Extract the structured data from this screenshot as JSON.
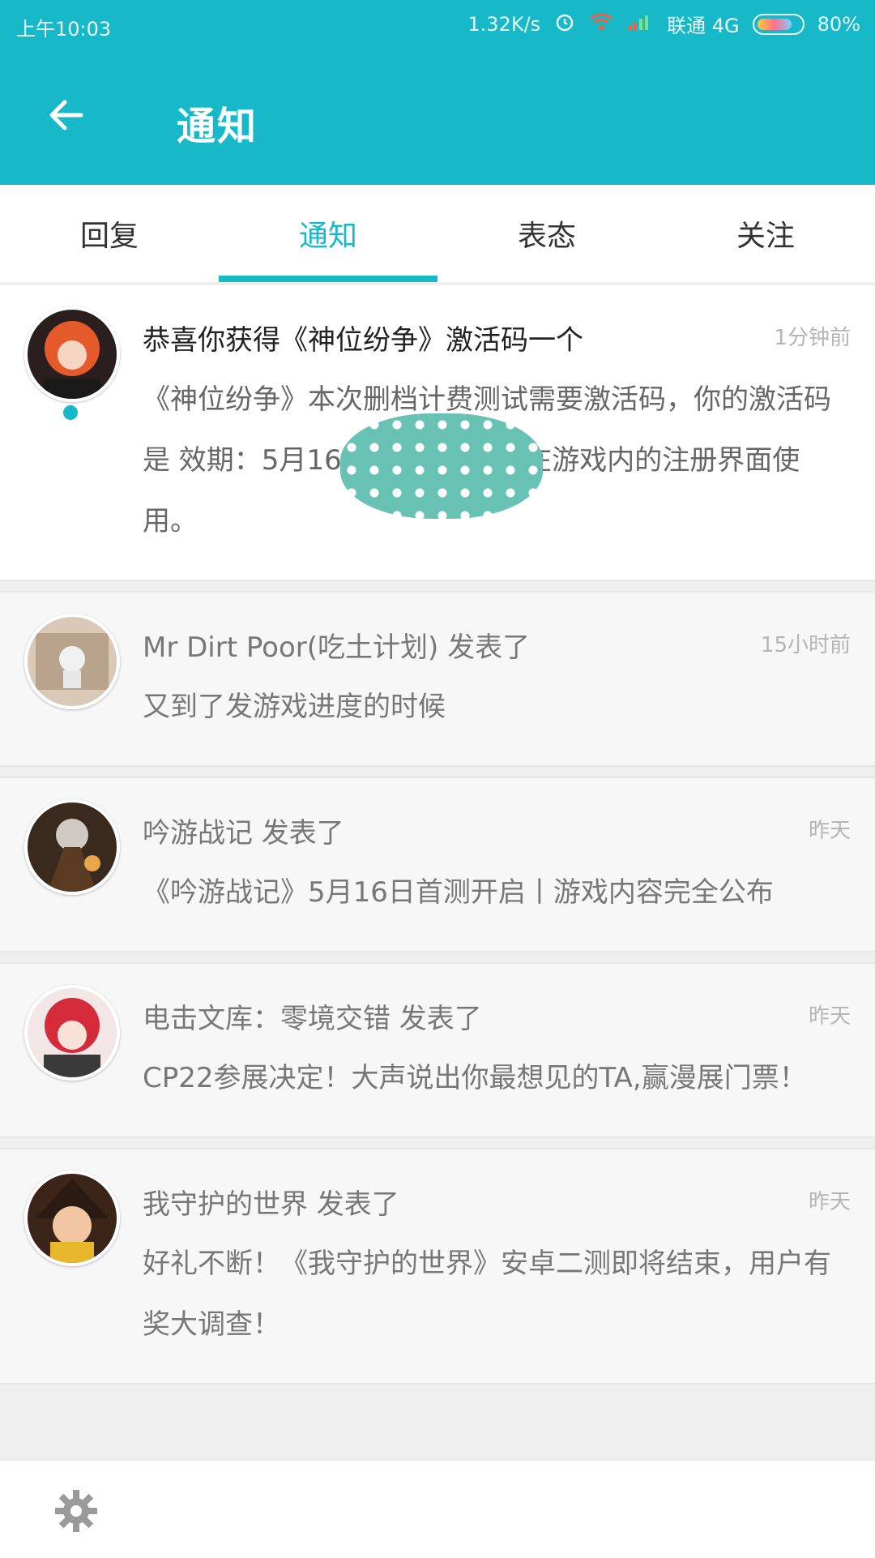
{
  "status_bar": {
    "time": "上午10:03",
    "speed": "1.32K/s",
    "carrier": "联通 4G",
    "battery": "80%",
    "battery_level": 0.8
  },
  "app_bar": {
    "title": "通知"
  },
  "tabs": [
    {
      "label": "回复",
      "active": false
    },
    {
      "label": "通知",
      "active": true
    },
    {
      "label": "表态",
      "active": false
    },
    {
      "label": "关注",
      "active": false
    }
  ],
  "notifications": [
    {
      "title": "恭喜你获得《神位纷争》激活码一个",
      "time": "1分钟前",
      "body": "《神位纷争》本次删档计费测试需要激活码，你的激活码是                    效期：5月16日-6月1日，请在游戏内的注册界面使用。",
      "unread": true
    },
    {
      "title": "Mr Dirt Poor(吃土计划) 发表了",
      "time": "15小时前",
      "body": "又到了发游戏进度的时候"
    },
    {
      "title": "吟游战记 发表了",
      "time": "昨天",
      "body": "《吟游战记》5月16日首测开启丨游戏内容完全公布"
    },
    {
      "title": "电击文库：零境交错 发表了",
      "time": "昨天",
      "body": "CP22参展决定！大声说出你最想见的TA,赢漫展门票！"
    },
    {
      "title": "我守护的世界 发表了",
      "time": "昨天",
      "body": "好礼不断！《我守护的世界》安卓二测即将结束，用户有奖大调查！"
    }
  ],
  "colors": {
    "accent": "#17b9c8"
  }
}
